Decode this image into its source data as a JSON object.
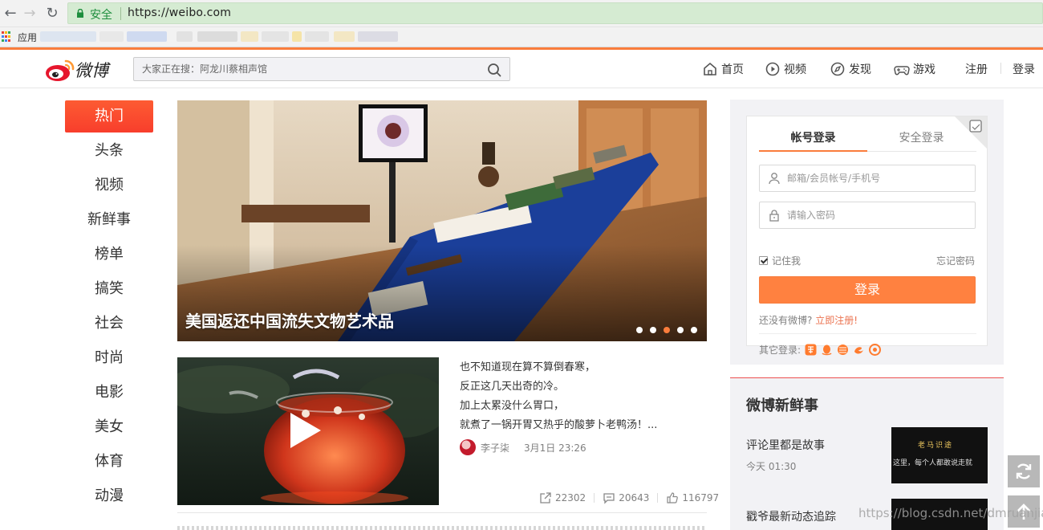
{
  "browser": {
    "secure_label": "安全",
    "url": "https://weibo.com",
    "apps_label": "应用"
  },
  "header": {
    "logo_text": "微博",
    "search_placeholder": "大家正在搜：阿龙川蔡相声馆",
    "nav": {
      "home": "首页",
      "video": "视频",
      "discover": "发现",
      "games": "游戏",
      "register": "注册",
      "login": "登录"
    }
  },
  "menu": [
    "热门",
    "头条",
    "视频",
    "新鲜事",
    "榜单",
    "搞笑",
    "社会",
    "时尚",
    "电影",
    "美女",
    "体育",
    "动漫"
  ],
  "banner": {
    "caption": "美国返还中国流失文物艺术品",
    "active_dot": 3,
    "dot_count": 5
  },
  "feed": {
    "lines": [
      "也不知道现在算不算倒春寒，",
      "反正这几天出奇的冷。",
      "加上太累没什么胃口，",
      "就煮了一锅开胃又热乎的酸萝卜老鸭汤！..."
    ],
    "author": "李子柒",
    "date": "3月1日 23:26",
    "reposts": "22302",
    "comments": "20643",
    "likes": "116797"
  },
  "login": {
    "tab_account": "帐号登录",
    "tab_secure": "安全登录",
    "username_placeholder": "邮箱/会员帐号/手机号",
    "password_placeholder": "请输入密码",
    "remember": "记住我",
    "forgot": "忘记密码",
    "button": "登录",
    "no_account": "还没有微博?",
    "register_link": "立即注册!",
    "other_login": "其它登录:"
  },
  "news": {
    "title": "微博新鲜事",
    "item1_title": "评论里都是故事",
    "item1_time": "今天 01:30",
    "item1_thumb_title": "老马识途",
    "item1_thumb_body": "这里，每个人都敢说走就",
    "item2_title": "戳爷最新动态追踪"
  },
  "watermark": "https://blog.csdn.net/dmruanjian",
  "colors": {
    "accent": "#fa7d3c",
    "hot_red": "#f83e2c",
    "login_button": "#ff8140",
    "address_bar": "#d5ebd2"
  }
}
